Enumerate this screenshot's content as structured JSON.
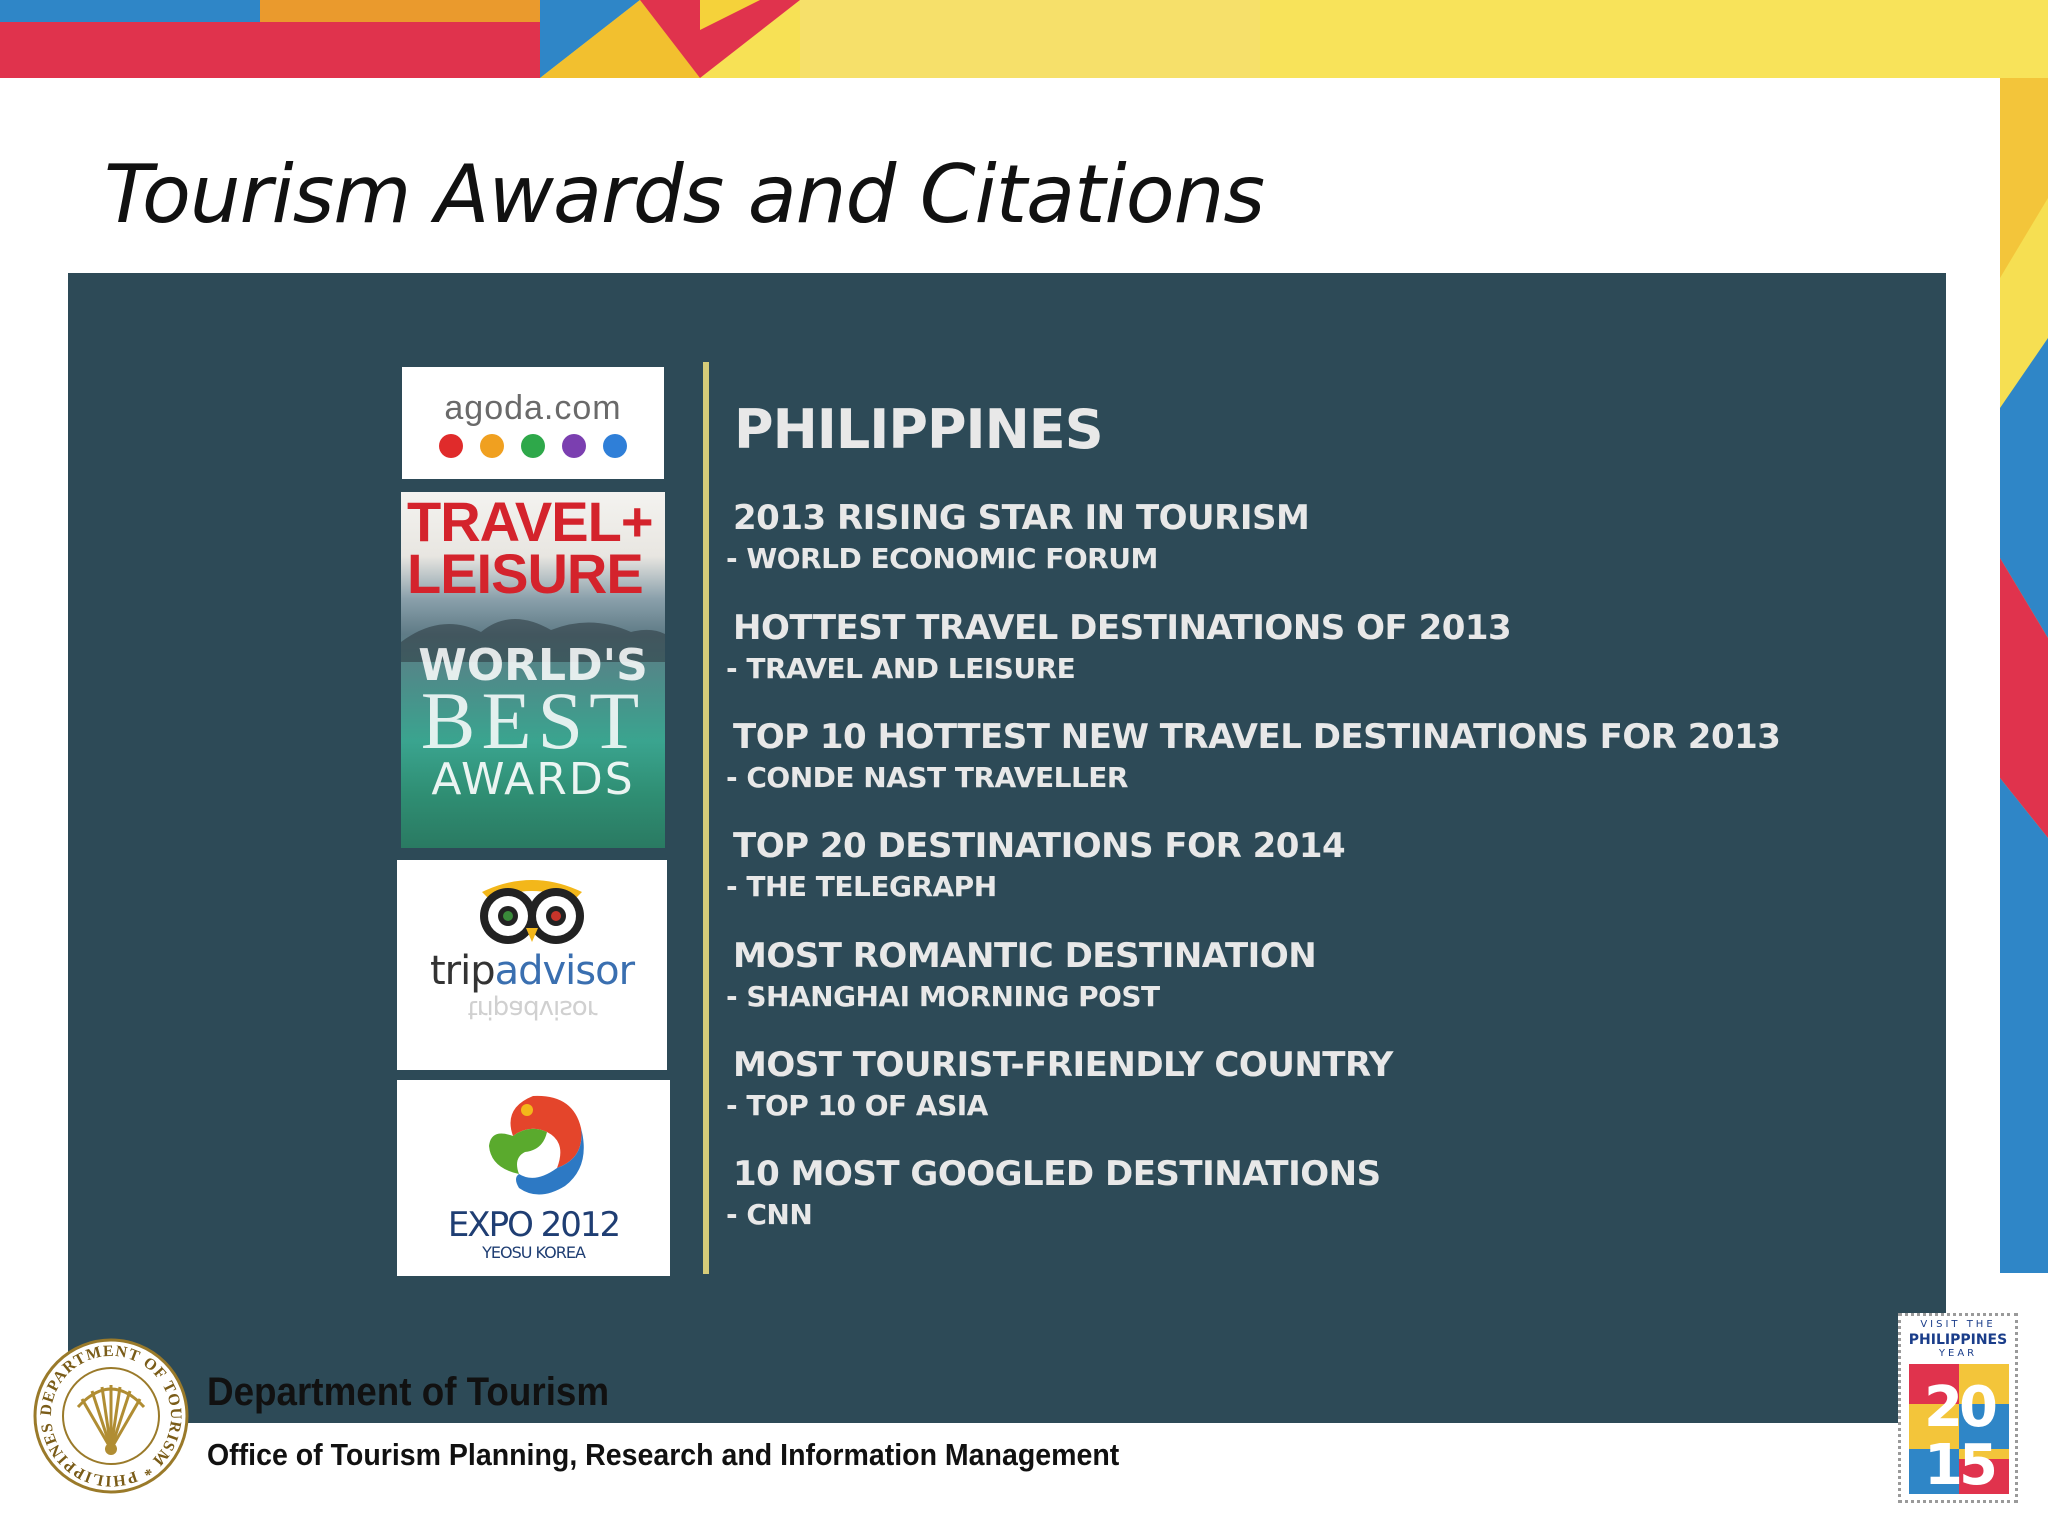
{
  "slide": {
    "title": "Tourism Awards and Citations",
    "heading": "PHILIPPINES",
    "awards": [
      {
        "name": "2013 RISING STAR IN TOURISM",
        "source": "- WORLD ECONOMIC FORUM"
      },
      {
        "name": "HOTTEST TRAVEL DESTINATIONS OF 2013",
        "source": "- TRAVEL AND LEISURE"
      },
      {
        "name": "TOP 10 HOTTEST NEW TRAVEL DESTINATIONS FOR 2013",
        "source": "- CONDE NAST TRAVELLER"
      },
      {
        "name": "TOP 20 DESTINATIONS FOR 2014",
        "source": "- THE TELEGRAPH"
      },
      {
        "name": "MOST ROMANTIC DESTINATION",
        "source": "- SHANGHAI MORNING POST"
      },
      {
        "name": "MOST TOURIST-FRIENDLY COUNTRY",
        "source": "- TOP 10 OF ASIA"
      },
      {
        "name": "10 MOST GOOGLED DESTINATIONS",
        "source": "- CNN"
      }
    ]
  },
  "logos": {
    "agoda": {
      "word": "agoda.com",
      "dot_colors": [
        "#e02b2b",
        "#f0a020",
        "#2ea84a",
        "#7b3fb0",
        "#2f7fd8"
      ]
    },
    "travel_leisure": {
      "name_line1": "TRAVEL+",
      "name_line2": "LEISURE",
      "worlds": "WORLD'S",
      "best": "BEST",
      "awards": "AWARDS"
    },
    "tripadvisor": {
      "trip": "trip",
      "advisor": "advisor"
    },
    "expo": {
      "line1": "EXPO 2012",
      "line2": "YEOSU KOREA"
    }
  },
  "footer": {
    "department": "Department of Tourism",
    "office": "Office of Tourism Planning, Research and Information Management",
    "seal_text": "DEPARTMENT OF TOURISM * PHILIPPINES *"
  },
  "stamp": {
    "top_line": "VISIT THE",
    "country": "PHILIPPINES",
    "year_label": "YEAR",
    "year": "2015"
  },
  "colors": {
    "panel": "#2d4a57",
    "divider": "#d6cc79",
    "banner_red": "#e0334d",
    "banner_yellow": "#f7e155"
  }
}
